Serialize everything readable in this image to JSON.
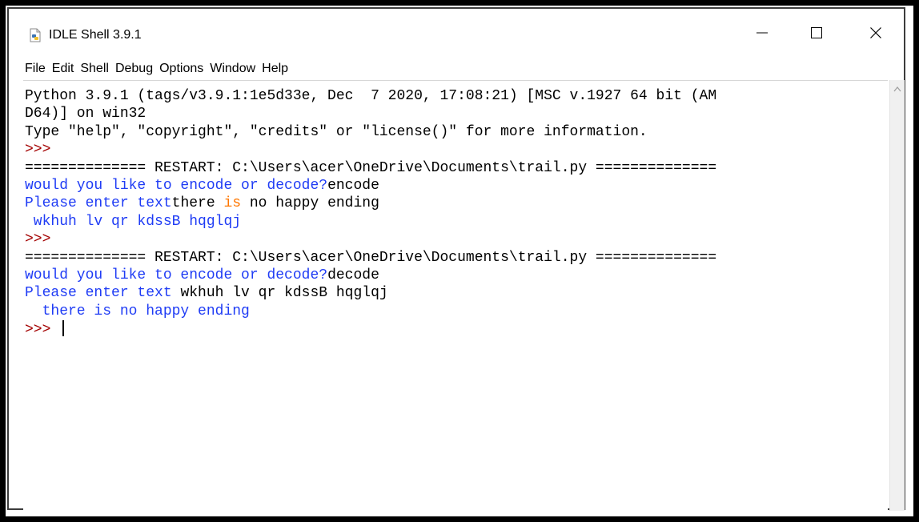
{
  "window": {
    "title": "IDLE Shell 3.9.1",
    "minimize_icon": "minimize-icon",
    "maximize_icon": "maximize-icon",
    "close_icon": "close-icon"
  },
  "menu": [
    "File",
    "Edit",
    "Shell",
    "Debug",
    "Options",
    "Window",
    "Help"
  ],
  "console": {
    "lines": [
      [
        {
          "text": "Python 3.9.1 (tags/v3.9.1:1e5d33e, Dec  7 2020, 17:08:21) [MSC v.1927 64 bit (AM",
          "style": "c-in"
        }
      ],
      [
        {
          "text": "D64)] on win32",
          "style": "c-in"
        }
      ],
      [
        {
          "text": "Type \"help\", \"copyright\", \"credits\" or \"license()\" for more information.",
          "style": "c-in"
        }
      ],
      [
        {
          "text": ">>>",
          "style": "c-prompt"
        }
      ],
      [
        {
          "text": "============== RESTART: C:\\Users\\acer\\OneDrive\\Documents\\trail.py ==============",
          "style": "c-in"
        }
      ],
      [
        {
          "text": "would you like to encode or decode?",
          "style": "c-stdout"
        },
        {
          "text": "encode",
          "style": "c-in"
        }
      ],
      [
        {
          "text": "Please enter text",
          "style": "c-stdout"
        },
        {
          "text": "there ",
          "style": "c-in"
        },
        {
          "text": "is",
          "style": "c-kw"
        },
        {
          "text": " no happy ending",
          "style": "c-in"
        }
      ],
      [
        {
          "text": " wkhuh lv qr kdssB hqglqj",
          "style": "c-stdout"
        }
      ],
      [
        {
          "text": ">>>",
          "style": "c-prompt"
        }
      ],
      [
        {
          "text": "============== RESTART: C:\\Users\\acer\\OneDrive\\Documents\\trail.py ==============",
          "style": "c-in"
        }
      ],
      [
        {
          "text": "would you like to encode or decode?",
          "style": "c-stdout"
        },
        {
          "text": "decode",
          "style": "c-in"
        }
      ],
      [
        {
          "text": "Please enter text",
          "style": "c-stdout"
        },
        {
          "text": " wkhuh lv qr kdssB hqglqj",
          "style": "c-in"
        }
      ],
      [
        {
          "text": "  there is no happy ending",
          "style": "c-stdout"
        }
      ],
      [
        {
          "text": ">>> ",
          "style": "c-prompt"
        }
      ]
    ]
  },
  "colors": {
    "prompt": "#a30000",
    "stdout": "#1f3cf5",
    "keyword": "#ff7700"
  }
}
